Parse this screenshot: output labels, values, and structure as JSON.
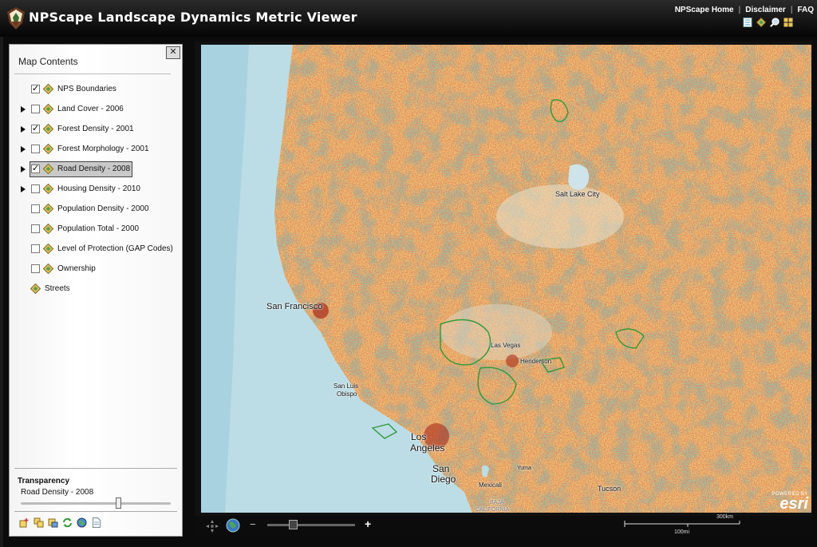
{
  "app": {
    "title": "NPScape Landscape Dynamics Metric Viewer",
    "links": [
      "NPScape Home",
      "Disclaimer",
      "FAQ"
    ],
    "link_separator": "|",
    "header_tools": [
      "legend-icon",
      "layers-icon",
      "zoom-icon",
      "grid-icon"
    ]
  },
  "panel": {
    "title": "Map Contents",
    "close_label": "✕",
    "layers": [
      {
        "label": "NPS Boundaries",
        "expandable": false,
        "checked": true
      },
      {
        "label": "Land Cover - 2006",
        "expandable": true,
        "checked": false
      },
      {
        "label": "Forest Density - 2001",
        "expandable": true,
        "checked": true
      },
      {
        "label": "Forest Morphology - 2001",
        "expandable": true,
        "checked": false
      },
      {
        "label": "Road Density - 2008",
        "expandable": true,
        "checked": true,
        "selected": true
      },
      {
        "label": "Housing Density - 2010",
        "expandable": true,
        "checked": false
      },
      {
        "label": "Population Density - 2000",
        "expandable": false,
        "checked": false
      },
      {
        "label": "Population Total - 2000",
        "expandable": false,
        "checked": false
      },
      {
        "label": "Level of Protection (GAP Codes)",
        "expandable": false,
        "checked": false
      },
      {
        "label": "Ownership",
        "expandable": false,
        "checked": false
      },
      {
        "label": "Streets",
        "expandable": false,
        "checked": null
      }
    ],
    "transparency": {
      "title": "Transparency",
      "layer": "Road Density - 2008",
      "value": 0.65
    },
    "bottom_tools": [
      "add-layer-icon",
      "copy-layer-icon",
      "duplicate-layer-icon",
      "refresh-icon",
      "globe-icon",
      "document-icon"
    ]
  },
  "map": {
    "labels": {
      "salt_lake": "Salt Lake City",
      "san_francisco": "San Francisco",
      "las_vegas": "Las Vegas",
      "henderson": "Henderson",
      "san_luis": "San Luis",
      "obispo": "Obispo",
      "los": "Los",
      "angeles": "Angeles",
      "san": "San",
      "diego": "Diego",
      "mexicali": "Mexicali",
      "tucson": "Tucson",
      "yuma": "Yuma",
      "baja": "BAJA",
      "california": "CALIFORNIA"
    },
    "attribution_powered": "POWERED BY",
    "attribution_name": "esri",
    "colors": {
      "ocean": "#bcdde6",
      "land_low": "#f0d678",
      "land_mid": "#e9b766",
      "road_high": "#c23a22",
      "forest": "#4e9a63",
      "nps_boundary": "#2f9a3a"
    }
  },
  "mapbar": {
    "zoom_minus": "−",
    "zoom_plus": "+",
    "zoom_level": 0.3,
    "scale_km": "300km",
    "scale_mi": "100mi"
  }
}
